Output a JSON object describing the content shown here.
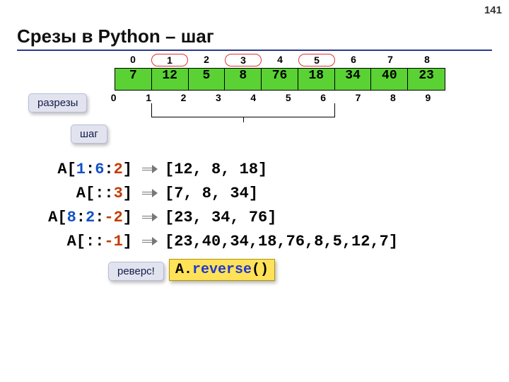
{
  "pageNumber": "141",
  "title": "Срезы в Python – шаг",
  "topIndices": [
    "0",
    "1",
    "2",
    "3",
    "4",
    "5",
    "6",
    "7",
    "8"
  ],
  "circled": [
    1,
    3,
    5
  ],
  "cells": [
    "7",
    "12",
    "5",
    "8",
    "76",
    "18",
    "34",
    "40",
    "23"
  ],
  "bottomIndices": [
    "0",
    "1",
    "2",
    "3",
    "4",
    "5",
    "6",
    "7",
    "8",
    "9"
  ],
  "labels": {
    "cuts": "разрезы",
    "step": "шаг",
    "reverse": "реверс!"
  },
  "slices": [
    {
      "a": "A[",
      "n1": "1",
      "c1": ":",
      "n2": "6",
      "c2": ":",
      "n3": "2",
      "z": "]",
      "result": "[12, 8, 18]"
    },
    {
      "a": "A[",
      "n1": "",
      "c1": ":",
      "n2": "",
      "c2": ":",
      "n3": "3",
      "z": "]",
      "result": "[7, 8, 34]"
    },
    {
      "a": "A[",
      "n1": "8",
      "c1": ":",
      "n2": "2",
      "c2": ":",
      "n3": "-2",
      "z": "]",
      "result": "[23, 34, 76]"
    },
    {
      "a": "A[",
      "n1": "",
      "c1": ":",
      "n2": "",
      "c2": ":",
      "n3": "-1",
      "z": "]",
      "result": "[23,40,34,18,76,8,5,12,7]"
    }
  ],
  "reverseCode": {
    "obj": "A.",
    "fn": "reverse",
    "tail": "()"
  }
}
